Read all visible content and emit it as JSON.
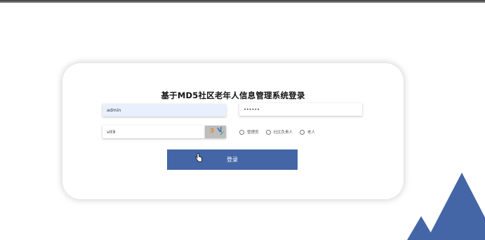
{
  "page": {
    "title": "基于MD5社区老年人信息管理系统登录"
  },
  "form": {
    "username_value": "admin",
    "password_value": "••••••",
    "captcha_value": "vit9",
    "captcha_image_text": [
      "3",
      "V",
      "y"
    ],
    "roles": [
      {
        "label": "管理员"
      },
      {
        "label": "社区负责人"
      },
      {
        "label": "老人"
      }
    ],
    "login_label": "登录"
  },
  "colors": {
    "accent": "#4466a6",
    "autofill": "#e8f0fe"
  },
  "icons": {
    "cursor": "hand-pointer-icon",
    "decoration": "mountains-icon"
  }
}
